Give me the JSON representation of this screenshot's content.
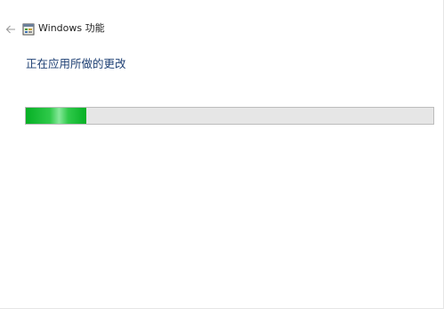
{
  "window": {
    "title": "Windows 功能",
    "back_icon": "back-arrow-icon",
    "app_icon": "windows-features-icon"
  },
  "main": {
    "heading": "正在应用所做的更改",
    "progress": {
      "fraction": 0.148,
      "accent": "#06b025",
      "track": "#e6e6e6"
    }
  }
}
